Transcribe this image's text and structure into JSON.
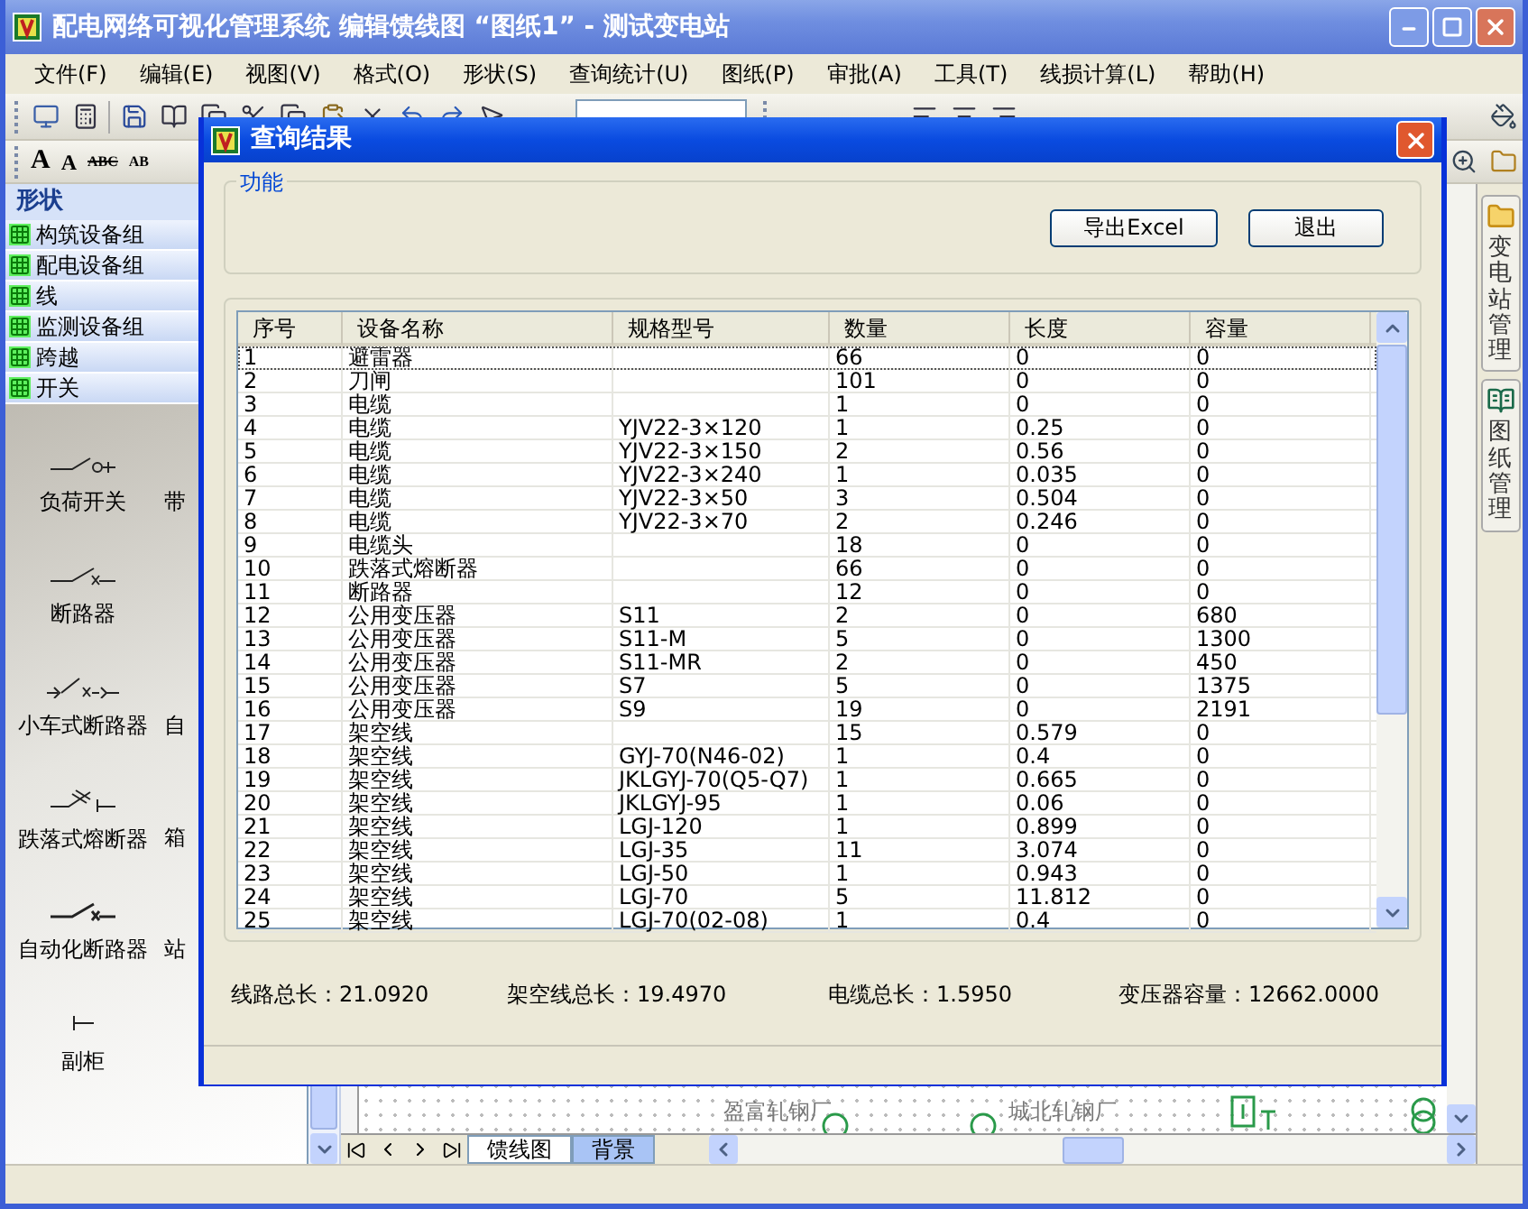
{
  "window": {
    "title": "配电网络可视化管理系统  编辑馈线图 “图纸1” - 测试变电站"
  },
  "menu": [
    "文件(F)",
    "编辑(E)",
    "视图(V)",
    "格式(O)",
    "形状(S)",
    "查询统计(U)",
    "图纸(P)",
    "审批(A)",
    "工具(T)",
    "线损计算(L)",
    "帮助(H)"
  ],
  "format_toolbar": [
    {
      "kind": "grow",
      "label": "A"
    },
    {
      "kind": "shrink",
      "label": "A"
    },
    {
      "kind": "strike",
      "label": "ABC"
    },
    {
      "kind": "plain",
      "label": "AB"
    }
  ],
  "shapes_panel": {
    "title": "形状",
    "groups": [
      "构筑设备组",
      "配电设备组",
      "线",
      "监测设备组",
      "跨越",
      "开关"
    ],
    "shapes": [
      {
        "label": "负荷开关",
        "kind": "load-switch"
      },
      {
        "label": "带",
        "kind": "none"
      },
      {
        "label": "断路器",
        "kind": "breaker"
      },
      {
        "kind": "empty"
      },
      {
        "label": "小车式断路器",
        "kind": "cart-breaker"
      },
      {
        "label": "自",
        "kind": "none"
      },
      {
        "label": "跌落式熔断器",
        "kind": "fuse"
      },
      {
        "label": "箱",
        "kind": "none"
      },
      {
        "label": "自动化断路器",
        "kind": "auto-breaker"
      },
      {
        "label": "站",
        "kind": "none"
      },
      {
        "label": "副柜",
        "kind": "sub-cabinet"
      }
    ]
  },
  "canvas": {
    "labels": [
      "盈富轧钢厂",
      "城北轧钢厂"
    ],
    "sheet_tabs": [
      {
        "label": "馈线图",
        "selected": true
      },
      {
        "label": "背景",
        "selected": false
      }
    ]
  },
  "right_tabs": [
    {
      "label": "变电站管理",
      "kind": "folder"
    },
    {
      "label": "图纸管理",
      "kind": "book"
    }
  ],
  "dialog": {
    "title": "查询结果",
    "group_label": "功能",
    "buttons": [
      "导出Excel",
      "退出"
    ],
    "table": {
      "columns": [
        "序号",
        "设备名称",
        "规格型号",
        "数量",
        "长度",
        "容量"
      ],
      "rows": [
        {
          "no": "1",
          "name": "避雷器",
          "qty": "66",
          "length": "0",
          "capacity": "0",
          "selected": true
        },
        {
          "no": "2",
          "name": "刀闸",
          "qty": "101",
          "length": "0",
          "capacity": "0",
          "selected": false
        },
        {
          "no": "3",
          "name": "电缆",
          "qty": "1",
          "length": "0",
          "capacity": "0",
          "selected": false
        },
        {
          "no": "4",
          "name": "电缆",
          "spec": "YJV22-3×120",
          "qty": "1",
          "length": "0.25",
          "capacity": "0",
          "selected": false
        },
        {
          "no": "5",
          "name": "电缆",
          "spec": "YJV22-3×150",
          "qty": "2",
          "length": "0.56",
          "capacity": "0",
          "selected": false
        },
        {
          "no": "6",
          "name": "电缆",
          "spec": "YJV22-3×240",
          "qty": "1",
          "length": "0.035",
          "capacity": "0",
          "selected": false
        },
        {
          "no": "7",
          "name": "电缆",
          "spec": "YJV22-3×50",
          "qty": "3",
          "length": "0.504",
          "capacity": "0",
          "selected": false
        },
        {
          "no": "8",
          "name": "电缆",
          "spec": "YJV22-3×70",
          "qty": "2",
          "length": "0.246",
          "capacity": "0",
          "selected": false
        },
        {
          "no": "9",
          "name": "电缆头",
          "qty": "18",
          "length": "0",
          "capacity": "0",
          "selected": false
        },
        {
          "no": "10",
          "name": "跌落式熔断器",
          "qty": "66",
          "length": "0",
          "capacity": "0",
          "selected": false
        },
        {
          "no": "11",
          "name": "断路器",
          "qty": "12",
          "length": "0",
          "capacity": "0",
          "selected": false
        },
        {
          "no": "12",
          "name": "公用变压器",
          "spec": "S11",
          "qty": "2",
          "length": "0",
          "capacity": "680",
          "selected": false
        },
        {
          "no": "13",
          "name": "公用变压器",
          "spec": "S11-M",
          "qty": "5",
          "length": "0",
          "capacity": "1300",
          "selected": false
        },
        {
          "no": "14",
          "name": "公用变压器",
          "spec": "S11-MR",
          "qty": "2",
          "length": "0",
          "capacity": "450",
          "selected": false
        },
        {
          "no": "15",
          "name": "公用变压器",
          "spec": "S7",
          "qty": "5",
          "length": "0",
          "capacity": "1375",
          "selected": false
        },
        {
          "no": "16",
          "name": "公用变压器",
          "spec": "S9",
          "qty": "19",
          "length": "0",
          "capacity": "2191",
          "selected": false
        },
        {
          "no": "17",
          "name": "架空线",
          "qty": "15",
          "length": "0.579",
          "capacity": "0",
          "selected": false
        },
        {
          "no": "18",
          "name": "架空线",
          "spec": "GYJ-70(N46-02)",
          "qty": "1",
          "length": "0.4",
          "capacity": "0",
          "selected": false
        },
        {
          "no": "19",
          "name": "架空线",
          "spec": "JKLGYJ-70(Q5-Q7)",
          "qty": "1",
          "length": "0.665",
          "capacity": "0",
          "selected": false
        },
        {
          "no": "20",
          "name": "架空线",
          "spec": "JKLGYJ-95",
          "qty": "1",
          "length": "0.06",
          "capacity": "0",
          "selected": false
        },
        {
          "no": "21",
          "name": "架空线",
          "spec": "LGJ-120",
          "qty": "1",
          "length": "0.899",
          "capacity": "0",
          "selected": false
        },
        {
          "no": "22",
          "name": "架空线",
          "spec": "LGJ-35",
          "qty": "11",
          "length": "3.074",
          "capacity": "0",
          "selected": false
        },
        {
          "no": "23",
          "name": "架空线",
          "spec": "LGJ-50",
          "qty": "1",
          "length": "0.943",
          "capacity": "0",
          "selected": false
        },
        {
          "no": "24",
          "name": "架空线",
          "spec": "LGJ-70",
          "qty": "5",
          "length": "11.812",
          "capacity": "0",
          "selected": false
        },
        {
          "no": "25",
          "name": "架空线",
          "spec": "LGJ-70(02-08)",
          "qty": "1",
          "length": "0.4",
          "capacity": "0",
          "selected": false
        }
      ]
    },
    "summary": [
      "线路总长：21.0920",
      "架空线总长：19.4970",
      "电缆总长：1.5950",
      "变压器容量：12662.0000"
    ]
  }
}
